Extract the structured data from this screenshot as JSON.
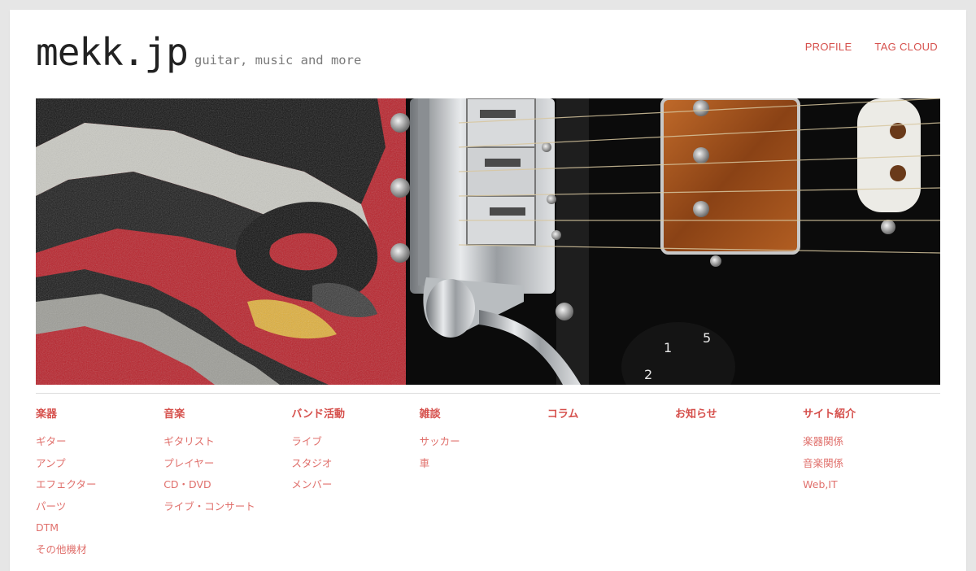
{
  "site": {
    "title": "mekk.jp",
    "tagline": "guitar, music and more"
  },
  "nav": [
    {
      "label": "PROFILE"
    },
    {
      "label": "TAG CLOUD"
    }
  ],
  "header_image": {
    "description_icon": "guitar-photo",
    "colors": {
      "pickguard_red": "#c0202a",
      "pickguard_black": "#151515",
      "chrome": "#bfc3c6",
      "pickup_copper": "#a5551f",
      "body_black": "#0c0c0c"
    }
  },
  "menu": [
    {
      "heading": "楽器",
      "items": [
        "ギター",
        "アンプ",
        "エフェクター",
        "パーツ",
        "DTM",
        "その他機材"
      ]
    },
    {
      "heading": "音楽",
      "items": [
        "ギタリスト",
        "プレイヤー",
        "CD・DVD",
        "ライブ・コンサート"
      ]
    },
    {
      "heading": "バンド活動",
      "items": [
        "ライブ",
        "スタジオ",
        "メンバー"
      ]
    },
    {
      "heading": "雑談",
      "items": [
        "サッカー",
        "車"
      ]
    },
    {
      "heading": "コラム",
      "items": []
    },
    {
      "heading": "お知らせ",
      "items": []
    },
    {
      "heading": "サイト紹介",
      "items": [
        "楽器関係",
        "音楽関係",
        "Web,IT"
      ]
    }
  ],
  "theme": {
    "accent": "#d6514d",
    "link_light": "#e0706c",
    "background": "#e6e6e6"
  }
}
